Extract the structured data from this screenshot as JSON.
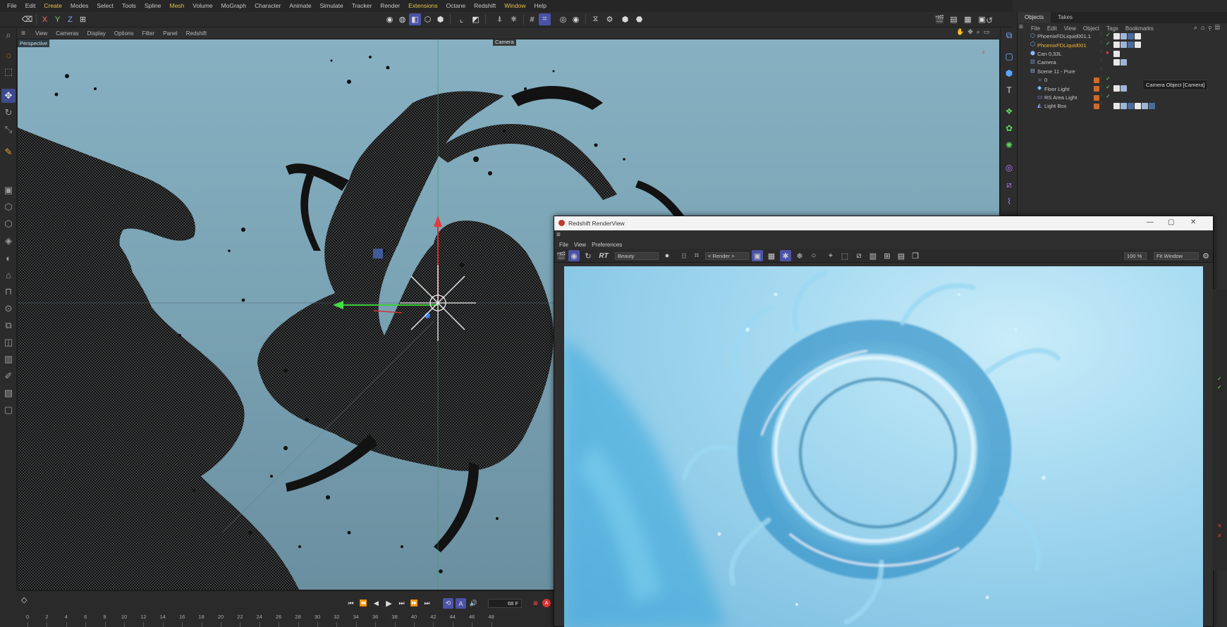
{
  "menubar": [
    "File",
    "Edit",
    "Create",
    "Modes",
    "Select",
    "Tools",
    "Spline",
    "Mesh",
    "Volume",
    "MoGraph",
    "Character",
    "Animate",
    "Simulate",
    "Tracker",
    "Render",
    "Extensions",
    "Octane",
    "Redshift",
    "Window",
    "Help"
  ],
  "menubar_highlight": [
    "Create",
    "Mesh",
    "Extensions",
    "Window"
  ],
  "axis_toggles": [
    "X",
    "Y",
    "Z"
  ],
  "viewport": {
    "menu": [
      "View",
      "Cameras",
      "Display",
      "Options",
      "Filter",
      "Panel",
      "Redshift"
    ],
    "label": "Perspective",
    "camera_label": "Camera"
  },
  "objects_panel": {
    "tabs": [
      "Objects",
      "Takes"
    ],
    "menu": [
      "File",
      "Edit",
      "View",
      "Object",
      "Tags",
      "Bookmarks"
    ],
    "rows": [
      {
        "name": "PhoenixFDLiquid001.1",
        "indent": 0,
        "highlight": false
      },
      {
        "name": "PhoenixFDLiquid001",
        "indent": 0,
        "highlight": true
      },
      {
        "name": "Can 0,33L",
        "indent": 0,
        "highlight": false
      },
      {
        "name": "Camera",
        "indent": 0,
        "highlight": false
      },
      {
        "name": "Scene 11 - Pure",
        "indent": 0,
        "highlight": false
      },
      {
        "name": "0",
        "indent": 1,
        "highlight": false
      },
      {
        "name": "Floor Light",
        "indent": 1,
        "highlight": false
      },
      {
        "name": "RS Area Light",
        "indent": 1,
        "highlight": false
      },
      {
        "name": "Light Box",
        "indent": 1,
        "highlight": false
      }
    ],
    "tooltip": "Camera Object [Camera]"
  },
  "timeline": {
    "frame_labels": [
      "0",
      "2",
      "4",
      "6",
      "8",
      "10",
      "12",
      "14",
      "16",
      "18",
      "20",
      "22",
      "24",
      "26",
      "28",
      "30",
      "32",
      "34",
      "36",
      "38",
      "40",
      "42",
      "44",
      "46",
      "48"
    ],
    "current_frame": "68 F"
  },
  "render_view": {
    "title": "Redshift RenderView",
    "menu": [
      "File",
      "View",
      "Preferences"
    ],
    "aov": "Beauty",
    "render_dropdown": "< Render >",
    "zoom": "100 %",
    "fit": "Fit Window",
    "rt_label": "RT"
  },
  "colors": {
    "accent": "#4c52a6",
    "highlight": "#e6c04a",
    "object_highlight": "#f2b632",
    "check": "#6fd36f"
  }
}
